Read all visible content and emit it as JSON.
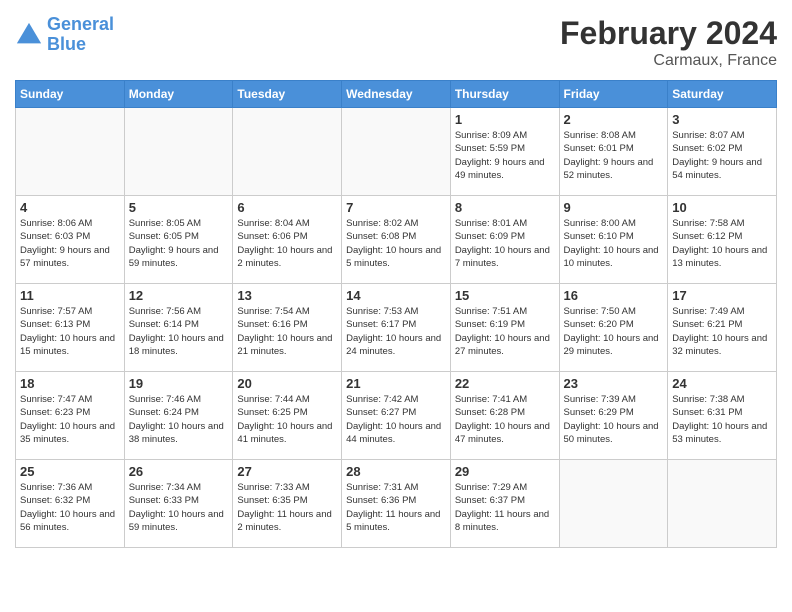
{
  "header": {
    "logo_line1": "General",
    "logo_line2": "Blue",
    "month_year": "February 2024",
    "location": "Carmaux, France"
  },
  "days_of_week": [
    "Sunday",
    "Monday",
    "Tuesday",
    "Wednesday",
    "Thursday",
    "Friday",
    "Saturday"
  ],
  "weeks": [
    [
      {
        "day": "",
        "info": ""
      },
      {
        "day": "",
        "info": ""
      },
      {
        "day": "",
        "info": ""
      },
      {
        "day": "",
        "info": ""
      },
      {
        "day": "1",
        "info": "Sunrise: 8:09 AM\nSunset: 5:59 PM\nDaylight: 9 hours\nand 49 minutes."
      },
      {
        "day": "2",
        "info": "Sunrise: 8:08 AM\nSunset: 6:01 PM\nDaylight: 9 hours\nand 52 minutes."
      },
      {
        "day": "3",
        "info": "Sunrise: 8:07 AM\nSunset: 6:02 PM\nDaylight: 9 hours\nand 54 minutes."
      }
    ],
    [
      {
        "day": "4",
        "info": "Sunrise: 8:06 AM\nSunset: 6:03 PM\nDaylight: 9 hours\nand 57 minutes."
      },
      {
        "day": "5",
        "info": "Sunrise: 8:05 AM\nSunset: 6:05 PM\nDaylight: 9 hours\nand 59 minutes."
      },
      {
        "day": "6",
        "info": "Sunrise: 8:04 AM\nSunset: 6:06 PM\nDaylight: 10 hours\nand 2 minutes."
      },
      {
        "day": "7",
        "info": "Sunrise: 8:02 AM\nSunset: 6:08 PM\nDaylight: 10 hours\nand 5 minutes."
      },
      {
        "day": "8",
        "info": "Sunrise: 8:01 AM\nSunset: 6:09 PM\nDaylight: 10 hours\nand 7 minutes."
      },
      {
        "day": "9",
        "info": "Sunrise: 8:00 AM\nSunset: 6:10 PM\nDaylight: 10 hours\nand 10 minutes."
      },
      {
        "day": "10",
        "info": "Sunrise: 7:58 AM\nSunset: 6:12 PM\nDaylight: 10 hours\nand 13 minutes."
      }
    ],
    [
      {
        "day": "11",
        "info": "Sunrise: 7:57 AM\nSunset: 6:13 PM\nDaylight: 10 hours\nand 15 minutes."
      },
      {
        "day": "12",
        "info": "Sunrise: 7:56 AM\nSunset: 6:14 PM\nDaylight: 10 hours\nand 18 minutes."
      },
      {
        "day": "13",
        "info": "Sunrise: 7:54 AM\nSunset: 6:16 PM\nDaylight: 10 hours\nand 21 minutes."
      },
      {
        "day": "14",
        "info": "Sunrise: 7:53 AM\nSunset: 6:17 PM\nDaylight: 10 hours\nand 24 minutes."
      },
      {
        "day": "15",
        "info": "Sunrise: 7:51 AM\nSunset: 6:19 PM\nDaylight: 10 hours\nand 27 minutes."
      },
      {
        "day": "16",
        "info": "Sunrise: 7:50 AM\nSunset: 6:20 PM\nDaylight: 10 hours\nand 29 minutes."
      },
      {
        "day": "17",
        "info": "Sunrise: 7:49 AM\nSunset: 6:21 PM\nDaylight: 10 hours\nand 32 minutes."
      }
    ],
    [
      {
        "day": "18",
        "info": "Sunrise: 7:47 AM\nSunset: 6:23 PM\nDaylight: 10 hours\nand 35 minutes."
      },
      {
        "day": "19",
        "info": "Sunrise: 7:46 AM\nSunset: 6:24 PM\nDaylight: 10 hours\nand 38 minutes."
      },
      {
        "day": "20",
        "info": "Sunrise: 7:44 AM\nSunset: 6:25 PM\nDaylight: 10 hours\nand 41 minutes."
      },
      {
        "day": "21",
        "info": "Sunrise: 7:42 AM\nSunset: 6:27 PM\nDaylight: 10 hours\nand 44 minutes."
      },
      {
        "day": "22",
        "info": "Sunrise: 7:41 AM\nSunset: 6:28 PM\nDaylight: 10 hours\nand 47 minutes."
      },
      {
        "day": "23",
        "info": "Sunrise: 7:39 AM\nSunset: 6:29 PM\nDaylight: 10 hours\nand 50 minutes."
      },
      {
        "day": "24",
        "info": "Sunrise: 7:38 AM\nSunset: 6:31 PM\nDaylight: 10 hours\nand 53 minutes."
      }
    ],
    [
      {
        "day": "25",
        "info": "Sunrise: 7:36 AM\nSunset: 6:32 PM\nDaylight: 10 hours\nand 56 minutes."
      },
      {
        "day": "26",
        "info": "Sunrise: 7:34 AM\nSunset: 6:33 PM\nDaylight: 10 hours\nand 59 minutes."
      },
      {
        "day": "27",
        "info": "Sunrise: 7:33 AM\nSunset: 6:35 PM\nDaylight: 11 hours\nand 2 minutes."
      },
      {
        "day": "28",
        "info": "Sunrise: 7:31 AM\nSunset: 6:36 PM\nDaylight: 11 hours\nand 5 minutes."
      },
      {
        "day": "29",
        "info": "Sunrise: 7:29 AM\nSunset: 6:37 PM\nDaylight: 11 hours\nand 8 minutes."
      },
      {
        "day": "",
        "info": ""
      },
      {
        "day": "",
        "info": ""
      }
    ]
  ]
}
